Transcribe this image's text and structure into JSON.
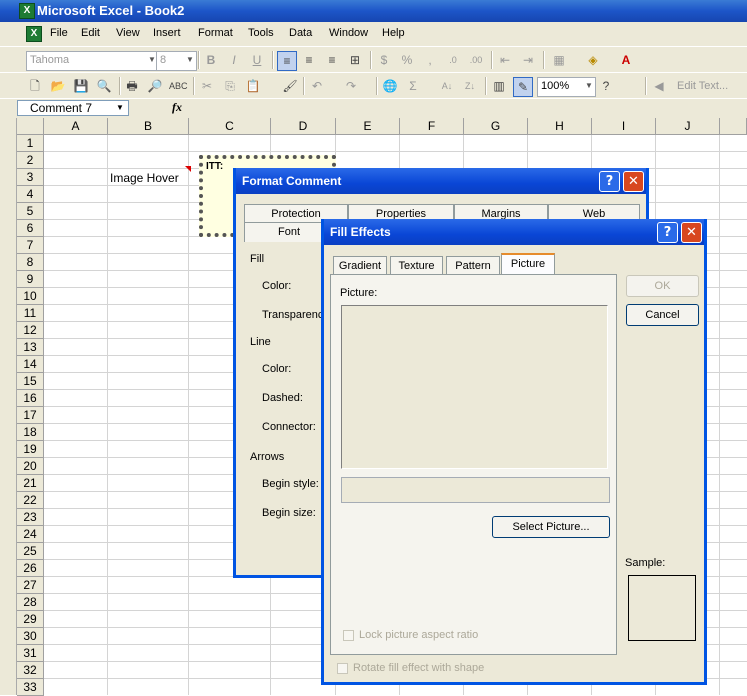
{
  "window": {
    "title": "Microsoft Excel - Book2"
  },
  "menu": [
    "File",
    "Edit",
    "View",
    "Insert",
    "Format",
    "Tools",
    "Data",
    "Window",
    "Help"
  ],
  "format_toolbar": {
    "font": "Tahoma",
    "size": "8",
    "bold": "B",
    "italic": "I",
    "underline": "U",
    "currency": "$",
    "percent": "%",
    "comma": ","
  },
  "standard_toolbar": {
    "zoom": "100%",
    "autosum": "Σ",
    "edit_text": "Edit Text..."
  },
  "formula_bar": {
    "name_box": "Comment 7",
    "fx": "fx"
  },
  "grid": {
    "columns": [
      "A",
      "B",
      "C",
      "D",
      "E",
      "F",
      "G",
      "H",
      "I",
      "J"
    ],
    "rows": [
      "1",
      "2",
      "3",
      "4",
      "5",
      "6",
      "7",
      "8",
      "9",
      "10",
      "11",
      "12",
      "13",
      "14",
      "15",
      "16",
      "17",
      "18",
      "19",
      "20",
      "21",
      "22",
      "23",
      "24",
      "25",
      "26",
      "27",
      "28",
      "29",
      "30",
      "31",
      "32",
      "33"
    ],
    "b3_text": "Image Hover",
    "comment_text": "ITT:"
  },
  "format_comment": {
    "title": "Format Comment",
    "tabs_row1": [
      "Protection",
      "Properties",
      "Margins",
      "Web"
    ],
    "tabs_row2": [
      "Font"
    ],
    "fill_label": "Fill",
    "color_label": "Color:",
    "transparency_label": "Transparency:",
    "line_label": "Line",
    "line_color_label": "Color:",
    "dashed_label": "Dashed:",
    "connector_label": "Connector:",
    "arrows_label": "Arrows",
    "begin_style_label": "Begin style:",
    "begin_size_label": "Begin size:"
  },
  "fill_effects": {
    "title": "Fill Effects",
    "tabs": [
      "Gradient",
      "Texture",
      "Pattern",
      "Picture"
    ],
    "active_tab": "Picture",
    "picture_label": "Picture:",
    "select_picture": "Select Picture...",
    "lock_aspect": "Lock picture aspect ratio",
    "rotate_fill": "Rotate fill effect with shape",
    "ok": "OK",
    "cancel": "Cancel",
    "sample": "Sample:"
  }
}
